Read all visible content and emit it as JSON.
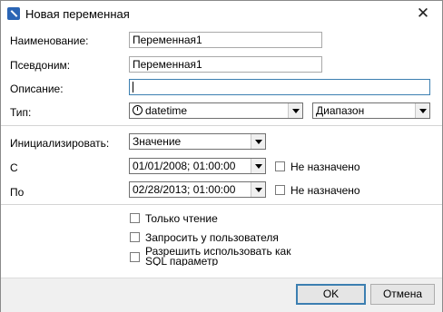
{
  "window": {
    "title": "Новая переменная",
    "close_glyph": "✕"
  },
  "fields": {
    "name_label": "Наименование:",
    "name_value": "Переменная1",
    "alias_label": "Псевдоним:",
    "alias_value": "Переменная1",
    "description_label": "Описание:",
    "description_value": "",
    "type_label": "Тип:",
    "type_value": "datetime",
    "type_icon": "datetime-icon",
    "kind_value": "Диапазон"
  },
  "init": {
    "label": "Инициализировать:",
    "value": "Значение",
    "from_label": "С",
    "from_value": "01/01/2008; 01:00:00",
    "from_unset_label": "Не назначено",
    "to_label": "По",
    "to_value": "02/28/2013; 01:00:00",
    "to_unset_label": "Не назначено"
  },
  "options": {
    "readonly_label": "Только чтение",
    "ask_user_label": "Запросить у пользователя",
    "sql_param_label": "Разрешить использовать как SQL параметр"
  },
  "buttons": {
    "ok": "OK",
    "cancel": "Отмена"
  }
}
